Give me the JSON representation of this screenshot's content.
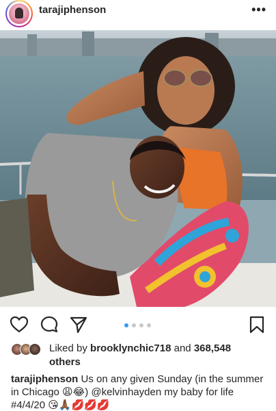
{
  "header": {
    "username": "tarajiphenson",
    "more_label": "•••",
    "avatar_icon": "profile-avatar"
  },
  "photo": {
    "description_icon": "post-photo",
    "carousel": {
      "count": 4,
      "active_index": 0
    }
  },
  "actions": {
    "like_icon": "heart-icon",
    "comment_icon": "comment-icon",
    "share_icon": "share-icon",
    "save_icon": "bookmark-icon"
  },
  "likes": {
    "prefix": "Liked by ",
    "user": "brooklynchic718",
    "middle": " and ",
    "count": "368,548",
    "suffix": "others"
  },
  "caption": {
    "username": "tarajiphenson",
    "text_part1": " Us on any given Sunday (in the summer in Chicago ",
    "emoji1": "😩😂",
    "text_part2": ") ",
    "mention": "@kelvinhayden",
    "text_part3": " my baby for life #4/4/20 ",
    "emoji2": "😘🙏🏾💋💋💋"
  },
  "colors": {
    "accent": "#3897f0",
    "text": "#262626"
  }
}
